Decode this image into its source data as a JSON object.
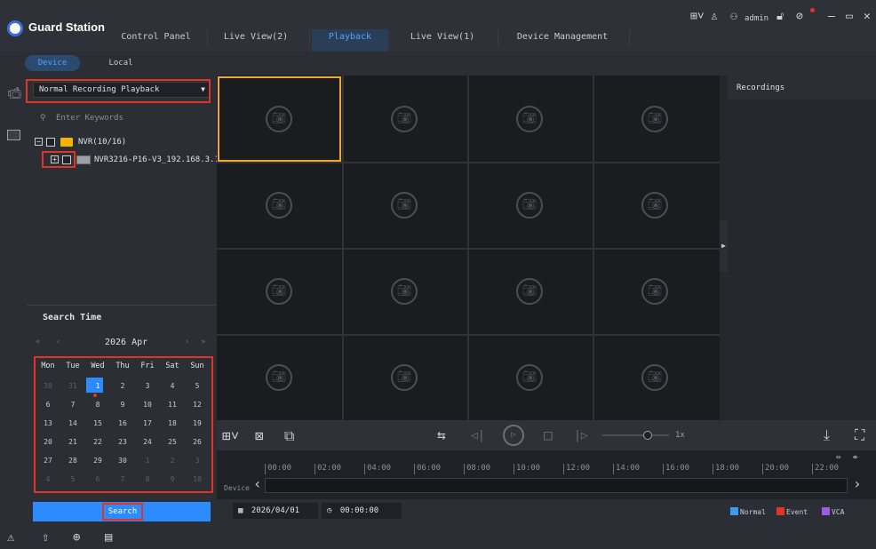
{
  "app": {
    "title": "Guard Station"
  },
  "tabs": [
    {
      "label": "Control Panel"
    },
    {
      "label": "Live View(2)"
    },
    {
      "label": "Playback"
    },
    {
      "label": "Live View(1)"
    },
    {
      "label": "Device Management"
    }
  ],
  "system_bar": {
    "user": "admin",
    "icons": [
      "layout-icon",
      "tshirt-icon",
      "group-icon",
      "lock-icon",
      "help-icon",
      "minimize-icon",
      "maximize-icon",
      "close-icon"
    ]
  },
  "source_tabs": {
    "device": "Device",
    "local": "Local"
  },
  "playback_type": {
    "selected": "Normal Recording Playback"
  },
  "search": {
    "placeholder": "Enter Keywords"
  },
  "device_tree": {
    "group_label": "NVR(10/16)",
    "device_label": "NVR3216-P16-V3_192.168.3.19···"
  },
  "search_time": {
    "title": "Search Time",
    "month_label": "2026 Apr",
    "weekdays": [
      "Mon",
      "Tue",
      "Wed",
      "Thu",
      "Fri",
      "Sat",
      "Sun"
    ],
    "weeks": [
      [
        "30",
        "31",
        "1",
        "2",
        "3",
        "4",
        "5"
      ],
      [
        "6",
        "7",
        "8",
        "9",
        "10",
        "11",
        "12"
      ],
      [
        "13",
        "14",
        "15",
        "16",
        "17",
        "18",
        "19"
      ],
      [
        "20",
        "21",
        "22",
        "23",
        "24",
        "25",
        "26"
      ],
      [
        "27",
        "28",
        "29",
        "30",
        "1",
        "2",
        "3"
      ],
      [
        "4",
        "5",
        "6",
        "7",
        "8",
        "9",
        "10"
      ]
    ],
    "selected_day": "1",
    "button_label": "Search"
  },
  "recordings": {
    "title": "Recordings"
  },
  "playback_controls": {
    "speed": "1x"
  },
  "timeline": {
    "row_label": "Device",
    "ticks": [
      "00:00",
      "02:00",
      "04:00",
      "06:00",
      "08:00",
      "10:00",
      "12:00",
      "14:00",
      "16:00",
      "18:00",
      "20:00",
      "22:00"
    ]
  },
  "footer": {
    "date": "2026/04/01",
    "time": "00:00:00",
    "legend": [
      {
        "label": "Normal",
        "color": "#3a9bf0"
      },
      {
        "label": "Event",
        "color": "#e0342b"
      },
      {
        "label": "VCA",
        "color": "#9b5de5"
      }
    ]
  },
  "colors": {
    "accent": "#2b8bff",
    "selected_window": "#f0a830",
    "annotation": "#e0342b"
  }
}
